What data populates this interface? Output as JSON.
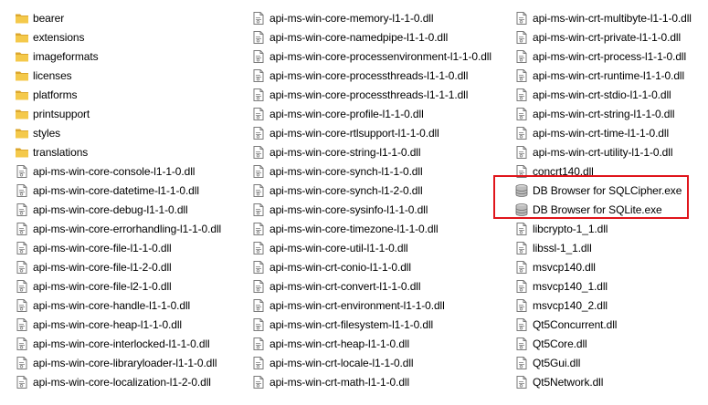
{
  "columns": [
    {
      "items": [
        {
          "label": "bearer",
          "type": "folder"
        },
        {
          "label": "extensions",
          "type": "folder"
        },
        {
          "label": "imageformats",
          "type": "folder"
        },
        {
          "label": "licenses",
          "type": "folder"
        },
        {
          "label": "platforms",
          "type": "folder"
        },
        {
          "label": "printsupport",
          "type": "folder"
        },
        {
          "label": "styles",
          "type": "folder"
        },
        {
          "label": "translations",
          "type": "folder"
        },
        {
          "label": "api-ms-win-core-console-l1-1-0.dll",
          "type": "dll"
        },
        {
          "label": "api-ms-win-core-datetime-l1-1-0.dll",
          "type": "dll"
        },
        {
          "label": "api-ms-win-core-debug-l1-1-0.dll",
          "type": "dll"
        },
        {
          "label": "api-ms-win-core-errorhandling-l1-1-0.dll",
          "type": "dll"
        },
        {
          "label": "api-ms-win-core-file-l1-1-0.dll",
          "type": "dll"
        },
        {
          "label": "api-ms-win-core-file-l1-2-0.dll",
          "type": "dll"
        },
        {
          "label": "api-ms-win-core-file-l2-1-0.dll",
          "type": "dll"
        },
        {
          "label": "api-ms-win-core-handle-l1-1-0.dll",
          "type": "dll"
        },
        {
          "label": "api-ms-win-core-heap-l1-1-0.dll",
          "type": "dll"
        },
        {
          "label": "api-ms-win-core-interlocked-l1-1-0.dll",
          "type": "dll"
        },
        {
          "label": "api-ms-win-core-libraryloader-l1-1-0.dll",
          "type": "dll"
        },
        {
          "label": "api-ms-win-core-localization-l1-2-0.dll",
          "type": "dll"
        }
      ]
    },
    {
      "items": [
        {
          "label": "api-ms-win-core-memory-l1-1-0.dll",
          "type": "dll"
        },
        {
          "label": "api-ms-win-core-namedpipe-l1-1-0.dll",
          "type": "dll"
        },
        {
          "label": "api-ms-win-core-processenvironment-l1-1-0.dll",
          "type": "dll"
        },
        {
          "label": "api-ms-win-core-processthreads-l1-1-0.dll",
          "type": "dll"
        },
        {
          "label": "api-ms-win-core-processthreads-l1-1-1.dll",
          "type": "dll"
        },
        {
          "label": "api-ms-win-core-profile-l1-1-0.dll",
          "type": "dll"
        },
        {
          "label": "api-ms-win-core-rtlsupport-l1-1-0.dll",
          "type": "dll"
        },
        {
          "label": "api-ms-win-core-string-l1-1-0.dll",
          "type": "dll"
        },
        {
          "label": "api-ms-win-core-synch-l1-1-0.dll",
          "type": "dll"
        },
        {
          "label": "api-ms-win-core-synch-l1-2-0.dll",
          "type": "dll"
        },
        {
          "label": "api-ms-win-core-sysinfo-l1-1-0.dll",
          "type": "dll"
        },
        {
          "label": "api-ms-win-core-timezone-l1-1-0.dll",
          "type": "dll"
        },
        {
          "label": "api-ms-win-core-util-l1-1-0.dll",
          "type": "dll"
        },
        {
          "label": "api-ms-win-crt-conio-l1-1-0.dll",
          "type": "dll"
        },
        {
          "label": "api-ms-win-crt-convert-l1-1-0.dll",
          "type": "dll"
        },
        {
          "label": "api-ms-win-crt-environment-l1-1-0.dll",
          "type": "dll"
        },
        {
          "label": "api-ms-win-crt-filesystem-l1-1-0.dll",
          "type": "dll"
        },
        {
          "label": "api-ms-win-crt-heap-l1-1-0.dll",
          "type": "dll"
        },
        {
          "label": "api-ms-win-crt-locale-l1-1-0.dll",
          "type": "dll"
        },
        {
          "label": "api-ms-win-crt-math-l1-1-0.dll",
          "type": "dll"
        }
      ]
    },
    {
      "items": [
        {
          "label": "api-ms-win-crt-multibyte-l1-1-0.dll",
          "type": "dll"
        },
        {
          "label": "api-ms-win-crt-private-l1-1-0.dll",
          "type": "dll"
        },
        {
          "label": "api-ms-win-crt-process-l1-1-0.dll",
          "type": "dll"
        },
        {
          "label": "api-ms-win-crt-runtime-l1-1-0.dll",
          "type": "dll"
        },
        {
          "label": "api-ms-win-crt-stdio-l1-1-0.dll",
          "type": "dll"
        },
        {
          "label": "api-ms-win-crt-string-l1-1-0.dll",
          "type": "dll"
        },
        {
          "label": "api-ms-win-crt-time-l1-1-0.dll",
          "type": "dll"
        },
        {
          "label": "api-ms-win-crt-utility-l1-1-0.dll",
          "type": "dll"
        },
        {
          "label": "concrt140.dll",
          "type": "dll"
        },
        {
          "label": "DB Browser for SQLCipher.exe",
          "type": "exe"
        },
        {
          "label": "DB Browser for SQLite.exe",
          "type": "exe"
        },
        {
          "label": "libcrypto-1_1.dll",
          "type": "dll"
        },
        {
          "label": "libssl-1_1.dll",
          "type": "dll"
        },
        {
          "label": "msvcp140.dll",
          "type": "dll"
        },
        {
          "label": "msvcp140_1.dll",
          "type": "dll"
        },
        {
          "label": "msvcp140_2.dll",
          "type": "dll"
        },
        {
          "label": "Qt5Concurrent.dll",
          "type": "dll"
        },
        {
          "label": "Qt5Core.dll",
          "type": "dll"
        },
        {
          "label": "Qt5Gui.dll",
          "type": "dll"
        },
        {
          "label": "Qt5Network.dll",
          "type": "dll"
        }
      ]
    }
  ],
  "icons": {
    "folder": "folder-icon",
    "dll": "dll-file-icon",
    "exe": "database-app-icon"
  },
  "highlight": {
    "color": "#e0151b",
    "items": [
      "DB Browser for SQLCipher.exe",
      "DB Browser for SQLite.exe"
    ]
  },
  "colors": {
    "folder": "#f4c94b",
    "folder_dark": "#dca72e",
    "text": "#000000"
  }
}
